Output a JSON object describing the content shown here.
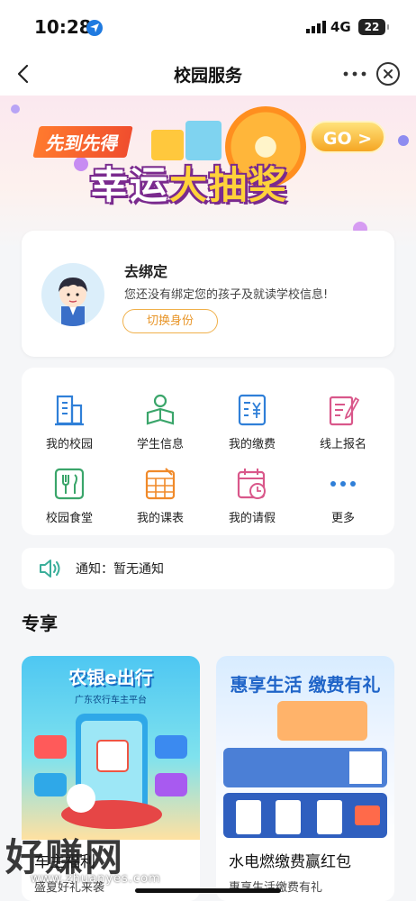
{
  "status_bar": {
    "time": "10:28",
    "network": "4G",
    "battery": "22"
  },
  "nav": {
    "title": "校园服务"
  },
  "banner": {
    "tag": "先到先得",
    "headline_part1": "幸运",
    "headline_part2": "大抽奖",
    "go": "GO >"
  },
  "bind_card": {
    "title": "去绑定",
    "description": "您还没有绑定您的孩子及就读学校信息!",
    "switch_label": "切换身份"
  },
  "grid": [
    {
      "label": "我的校园",
      "icon": "school-building-icon",
      "color": "#2f7fd8"
    },
    {
      "label": "学生信息",
      "icon": "student-info-icon",
      "color": "#3aa56a"
    },
    {
      "label": "我的缴费",
      "icon": "payment-yuan-icon",
      "color": "#2f7fd8"
    },
    {
      "label": "线上报名",
      "icon": "online-signup-icon",
      "color": "#d9578a"
    },
    {
      "label": "校园食堂",
      "icon": "canteen-icon",
      "color": "#3aa56a"
    },
    {
      "label": "我的课表",
      "icon": "timetable-icon",
      "color": "#f08a2a"
    },
    {
      "label": "我的请假",
      "icon": "leave-calendar-icon",
      "color": "#d9578a"
    },
    {
      "label": "更多",
      "icon": "more-dots-icon",
      "color": "#2f7fd8"
    }
  ],
  "notice": {
    "text": "通知：暂无通知"
  },
  "section": {
    "title": "专享"
  },
  "promos": [
    {
      "image_title": "农银e出行",
      "image_sub": "广东农行车主平台",
      "title": "车主福利",
      "subtitle": "盛夏好礼来袭"
    },
    {
      "image_title": "惠享生活 缴费有礼",
      "image_sub": "",
      "title": "水电燃缴费赢红包",
      "subtitle": "惠享生活缴费有礼"
    }
  ],
  "watermark": {
    "text": "好赚网",
    "url": "www.zhuanyes.com"
  }
}
